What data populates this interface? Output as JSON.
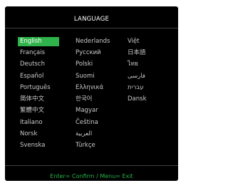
{
  "menu": {
    "title": "LANGUAGE",
    "selected_color": "#2fb34a",
    "footer_color": "#27b34a",
    "columns": [
      [
        "English",
        "Français",
        "Deutsch",
        "Español",
        "Português",
        "简体中文",
        "繁體中文",
        "Italiano",
        "Norsk",
        "Svenska"
      ],
      [
        "Nederlands",
        "Русский",
        "Polski",
        "Suomi",
        "Ελληνικά",
        "한국어",
        "Magyar",
        "Čeština",
        "العربية",
        "Türkçe"
      ],
      [
        "Việt",
        "日本語",
        "ไทย",
        "فارسی",
        "עברית",
        "Dansk"
      ]
    ],
    "selected": "English",
    "footer": "Enter= Confirm / Menu= Exit"
  }
}
